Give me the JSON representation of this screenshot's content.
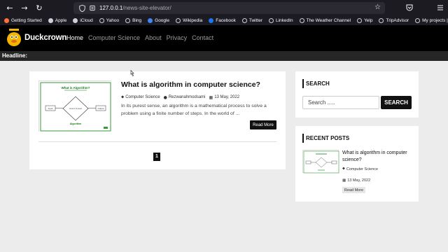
{
  "browser": {
    "url_host": "127.0.0.1",
    "url_path": "/news-site-elevator/",
    "bookmarks": [
      {
        "label": "Getting Started",
        "icon": "firefox-icon",
        "color": "#ff7139"
      },
      {
        "label": "Apple",
        "icon": "apple-icon",
        "color": "#cfcfd8"
      },
      {
        "label": "iCloud",
        "icon": "icloud-icon",
        "color": "#cfcfd8"
      },
      {
        "label": "Yahoo",
        "icon": "globe-icon",
        "color": "#cfcfd8"
      },
      {
        "label": "Bing",
        "icon": "globe-icon",
        "color": "#cfcfd8"
      },
      {
        "label": "Google",
        "icon": "google-icon",
        "color": "#4285f4"
      },
      {
        "label": "Wikipedia",
        "icon": "globe-icon",
        "color": "#cfcfd8"
      },
      {
        "label": "Facebook",
        "icon": "facebook-icon",
        "color": "#1877f2"
      },
      {
        "label": "Twitter",
        "icon": "globe-icon",
        "color": "#cfcfd8"
      },
      {
        "label": "LinkedIn",
        "icon": "globe-icon",
        "color": "#cfcfd8"
      },
      {
        "label": "The Weather Channel",
        "icon": "globe-icon",
        "color": "#cfcfd8"
      },
      {
        "label": "Yelp",
        "icon": "globe-icon",
        "color": "#cfcfd8"
      },
      {
        "label": "TripAdvisor",
        "icon": "globe-icon",
        "color": "#cfcfd8"
      },
      {
        "label": "My projects | SVGator",
        "icon": "globe-icon",
        "color": "#cfcfd8"
      }
    ]
  },
  "site": {
    "logo_text": "Duckcrown",
    "nav": [
      "Home",
      "Computer Science",
      "About",
      "Privacy",
      "Contact"
    ],
    "headline_label": "Headline:"
  },
  "post": {
    "title": "What is algorithm in computer science?",
    "category": "Computer Science",
    "author": "Rezwanahmodsami",
    "date": "13 May, 2022",
    "excerpt": "In its purest sense, an algorithm is a mathematical process to solve a problem using a finite number of steps. In the world of ...",
    "read_more": "Read More",
    "thumb_title": "What is Algorithm?",
    "thumb_input": "Input",
    "thumb_output": "Output",
    "thumb_center": "How it is used",
    "thumb_caption": "Algorithm"
  },
  "pagination": {
    "current": "1"
  },
  "sidebar": {
    "search_title": "SEARCH",
    "search_placeholder": "Search .....",
    "search_button": "SEARCH",
    "recent_title": "RECENT POSTS",
    "recent": {
      "title": "What is algorithm in computer science?",
      "category": "Computer Science",
      "date": "13 May, 2022",
      "read_more": "Read More"
    }
  }
}
